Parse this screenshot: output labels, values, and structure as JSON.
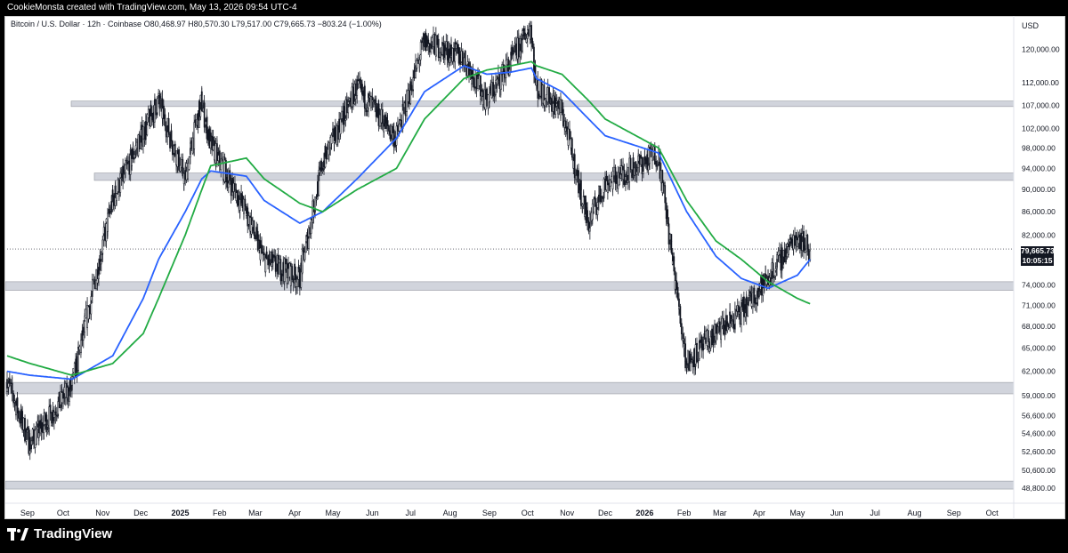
{
  "header": {
    "credit": "CookieMonsta created with TradingView.com, May 13, 2026 09:54 UTC-4"
  },
  "legend": {
    "symbol_line": "Bitcoin / U.S. Dollar · 12h · Coinbase  O80,468.97  H80,570.30  L79,517.00  C79,665.73  −803.24 (−1.00%)"
  },
  "price_axis": {
    "currency": "USD",
    "last_price": "79,665.73",
    "countdown": "10:05:15"
  },
  "footer": {
    "brand": "TradingView"
  },
  "colors": {
    "candles": "#131722",
    "ma_fast": "#2962ff",
    "ma_slow": "#22ab44",
    "zones": "#d1d4dc"
  },
  "chart_data": {
    "type": "line",
    "y_scale": "log",
    "ylim": [
      48000,
      128000
    ],
    "y_ticks": [
      "120,000.00",
      "112,000.00",
      "107,000.00",
      "102,000.00",
      "98,000.00",
      "94,000.00",
      "90,000.00",
      "86,000.00",
      "82,000.00",
      "74,000.00",
      "71,000.00",
      "68,000.00",
      "65,000.00",
      "62,000.00",
      "59,000.00",
      "56,600.00",
      "54,600.00",
      "52,600.00",
      "50,600.00",
      "48,800.00"
    ],
    "x_ticks": [
      "Sep",
      "Oct",
      "Nov",
      "Dec",
      "2025",
      "Feb",
      "Mar",
      "Apr",
      "May",
      "Jun",
      "Jul",
      "Aug",
      "Sep",
      "Oct",
      "Nov",
      "Dec",
      "2026",
      "Feb",
      "Mar",
      "Apr",
      "May",
      "Jun",
      "Jul",
      "Aug",
      "Sep",
      "Oct"
    ],
    "x": [
      "2024-08-20",
      "2024-09-07",
      "2024-10-10",
      "2024-11-11",
      "2024-12-05",
      "2024-12-17",
      "2025-01-07",
      "2025-01-20",
      "2025-01-27",
      "2025-02-24",
      "2025-03-10",
      "2025-04-07",
      "2025-04-25",
      "2025-05-22",
      "2025-06-22",
      "2025-07-14",
      "2025-08-14",
      "2025-09-01",
      "2025-09-20",
      "2025-10-06",
      "2025-10-10",
      "2025-10-30",
      "2025-11-20",
      "2025-12-03",
      "2026-01-14",
      "2026-02-05",
      "2026-02-28",
      "2026-03-20",
      "2026-04-10",
      "2026-05-03",
      "2026-05-13"
    ],
    "series": [
      {
        "values": [
          61000,
          53500,
          60000,
          88000,
          101000,
          108000,
          92000,
          108000,
          99000,
          86000,
          78000,
          75000,
          95000,
          111000,
          100000,
          122000,
          118000,
          108000,
          117000,
          126000,
          111000,
          106000,
          84000,
          91000,
          97000,
          63000,
          67000,
          70000,
          75000,
          82000,
          79665.73
        ]
      },
      {
        "values": [
          62000,
          61500,
          61000,
          64000,
          72000,
          78000,
          86000,
          92000,
          93500,
          92500,
          88000,
          84000,
          86000,
          92000,
          100000,
          110000,
          116000,
          114000,
          114500,
          115500,
          113000,
          110000,
          104000,
          100500,
          97000,
          86000,
          78500,
          75000,
          73500,
          75500,
          78000
        ]
      },
      {
        "values": [
          64000,
          63000,
          61500,
          63000,
          67000,
          72000,
          82000,
          90000,
          94500,
          96000,
          92000,
          87500,
          86000,
          90000,
          94000,
          104000,
          113000,
          115000,
          116000,
          117000,
          116000,
          114000,
          108000,
          104000,
          98000,
          88000,
          81000,
          78000,
          74500,
          72000,
          71200
        ]
      }
    ],
    "zones": [
      [
        106700,
        107900
      ],
      [
        91700,
        93100
      ],
      [
        73200,
        74500
      ],
      [
        59200,
        60600
      ],
      [
        48700,
        49500
      ]
    ],
    "grid": false
  }
}
